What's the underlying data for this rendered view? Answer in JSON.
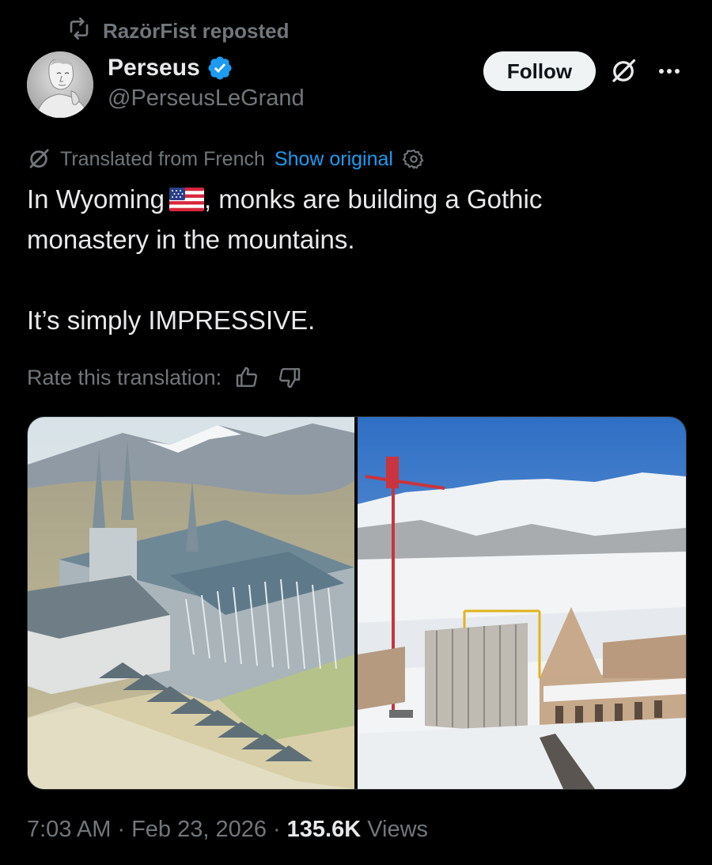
{
  "repost": {
    "label": "RazörFist reposted",
    "icon": "repost-icon"
  },
  "author": {
    "name": "Perseus",
    "handle": "@PerseusLeGrand",
    "verified": true,
    "avatar_icon": "statue-avatar"
  },
  "header": {
    "follow_label": "Follow",
    "grok_icon": "grok-icon",
    "more_icon": "more-options-icon"
  },
  "translation": {
    "translated_label": "Translated from French",
    "show_original_label": "Show original",
    "rate_label": "Rate this translation:"
  },
  "tweet": {
    "line1_before_flag": "In Wyoming",
    "flag_icon": "us-flag-emoji",
    "line1_after_flag": ", monks are building a Gothic",
    "line2": "monastery in the mountains.",
    "line3": "It’s simply IMPRESSIVE."
  },
  "meta": {
    "time": "7:03 AM",
    "separator": "·",
    "date": "Feb 23, 2026",
    "views_count": "135.6K",
    "views_label": "Views"
  },
  "colors": {
    "background": "#000000",
    "text_primary": "#e7e9ea",
    "text_secondary": "#71767b",
    "link": "#1d9bf0",
    "verified_badge": "#1d9bf0",
    "follow_button_bg": "#eff3f4"
  }
}
